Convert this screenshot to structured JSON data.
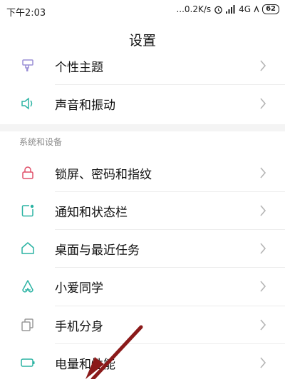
{
  "status_bar": {
    "time": "下午2:03",
    "net_speed": "...0.2K/s",
    "network": "4G",
    "battery": "62",
    "icons": [
      "alarm-icon",
      "signal-icon",
      "wifi-icon",
      "battery-icon"
    ]
  },
  "header": {
    "title": "设置"
  },
  "items_top": [
    {
      "label": "个性主题",
      "icon": "theme-brush-icon"
    },
    {
      "label": "声音和振动",
      "icon": "speaker-icon"
    }
  ],
  "section": {
    "title": "系统和设备"
  },
  "items_system": [
    {
      "label": "锁屏、密码和指纹",
      "icon": "lock-icon"
    },
    {
      "label": "通知和状态栏",
      "icon": "notification-icon"
    },
    {
      "label": "桌面与最近任务",
      "icon": "home-icon"
    },
    {
      "label": "小爱同学",
      "icon": "xiaoai-icon"
    },
    {
      "label": "手机分身",
      "icon": "second-space-icon"
    },
    {
      "label": "电量和性能",
      "icon": "battery-performance-icon"
    }
  ],
  "colors": {
    "icon_accent": "#2bb3a3",
    "theme_icon": "#9a8fd6",
    "lock_icon": "#e0506a",
    "annotation_arrow": "#8b1a1a"
  }
}
